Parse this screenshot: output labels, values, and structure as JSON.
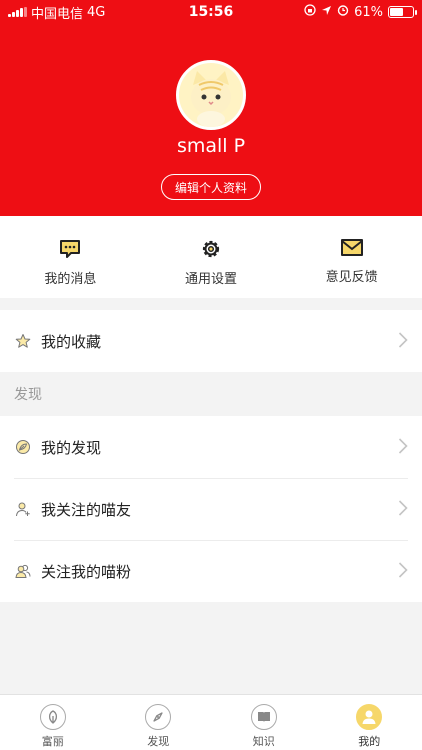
{
  "status_bar": {
    "carrier": "中国电信",
    "network": "4G",
    "time": "15:56",
    "battery": "61%",
    "battery_level": 0.61
  },
  "profile": {
    "username": "small P",
    "edit_label": "编辑个人资料"
  },
  "actions": [
    {
      "label": "我的消息",
      "icon": "message-icon"
    },
    {
      "label": "通用设置",
      "icon": "gear-icon"
    },
    {
      "label": "意见反馈",
      "icon": "envelope-icon"
    }
  ],
  "favorites": {
    "label": "我的收藏",
    "icon": "star-icon"
  },
  "discover_section": {
    "title": "发现",
    "items": [
      {
        "label": "我的发现",
        "icon": "leaf-icon"
      },
      {
        "label": "我关注的喵友",
        "icon": "user-add-icon"
      },
      {
        "label": "关注我的喵粉",
        "icon": "users-icon"
      }
    ]
  },
  "tabbar": [
    {
      "label": "富丽",
      "icon": "home-icon",
      "active": false
    },
    {
      "label": "发现",
      "icon": "compass-icon",
      "active": false
    },
    {
      "label": "知识",
      "icon": "book-icon",
      "active": false
    },
    {
      "label": "我的",
      "icon": "user-icon",
      "active": true
    }
  ],
  "colors": {
    "brand_red": "#ee0e14",
    "accent_yellow": "#f6d76a"
  }
}
